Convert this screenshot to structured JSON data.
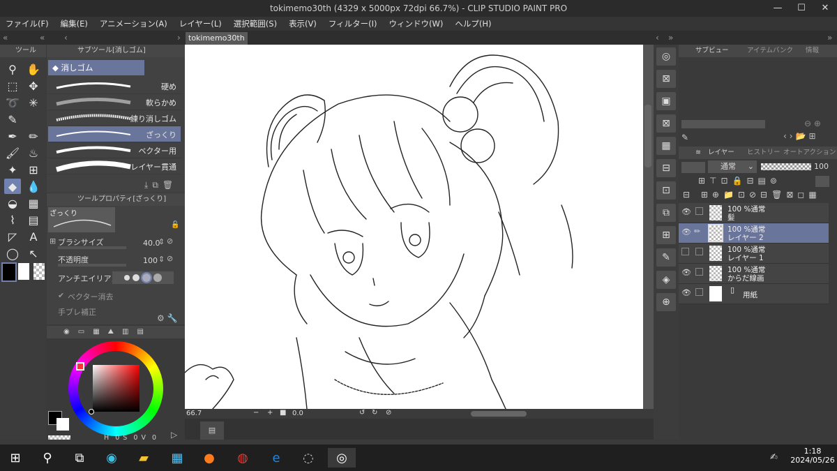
{
  "window": {
    "title": "tokimemo30th (4329 x 5000px 72dpi 66.7%) - CLIP STUDIO PAINT PRO",
    "min": "—",
    "max": "☐",
    "close": "✕"
  },
  "menu": [
    "ファイル(F)",
    "編集(E)",
    "アニメーション(A)",
    "レイヤー(L)",
    "選択範囲(S)",
    "表示(V)",
    "フィルター(I)",
    "ウィンドウ(W)",
    "ヘルプ(H)"
  ],
  "document_tab": "tokimemo30th",
  "tool_panel": {
    "title": "ツール"
  },
  "subtool": {
    "title": "サブツール[消しゴム]",
    "group": "消しゴム",
    "brushes": [
      "硬め",
      "軟らかめ",
      "練り消しゴム",
      "ざっくり",
      "ベクター用",
      "レイヤー貫通"
    ],
    "selected_index": 3
  },
  "tool_property": {
    "title": "ツールプロパティ[ざっくり]",
    "preset": "ざっくり",
    "brush_size_label": "ブラシサイズ",
    "brush_size_value": "40.0",
    "opacity_label": "不透明度",
    "opacity_value": "100",
    "antialias_label": "アンチエイリアス",
    "vector_erase_label": "ベクター消去",
    "stabilization_label": "手ブレ補正"
  },
  "color": {
    "hsv": [
      "H",
      "0",
      "S",
      "0",
      "V",
      "0"
    ],
    "main": "#000000",
    "sub": "#ffffff",
    "hue": "#ff0000"
  },
  "canvas_status": {
    "zoom": "66.7",
    "angle": "0.0"
  },
  "right": {
    "subview_tabs": [
      "サブビュー",
      "アイテムバンク",
      "情報"
    ],
    "layer_tabs": [
      "レイヤー",
      "ヒストリー",
      "オートアクション"
    ],
    "blend_mode": "通常",
    "opacity": "100",
    "layers": [
      {
        "line1": "100 %通常",
        "line2": "髪",
        "selected": false
      },
      {
        "line1": "100 %通常",
        "line2": "レイヤー 2",
        "selected": true
      },
      {
        "line1": "100 %通常",
        "line2": "レイヤー 1",
        "selected": false
      },
      {
        "line1": "100 %通常",
        "line2": "からだ線画",
        "selected": false
      },
      {
        "line1": "",
        "line2": "用紙",
        "selected": false
      }
    ]
  },
  "taskbar": {
    "time": "1:18",
    "date": "2024/05/26"
  }
}
